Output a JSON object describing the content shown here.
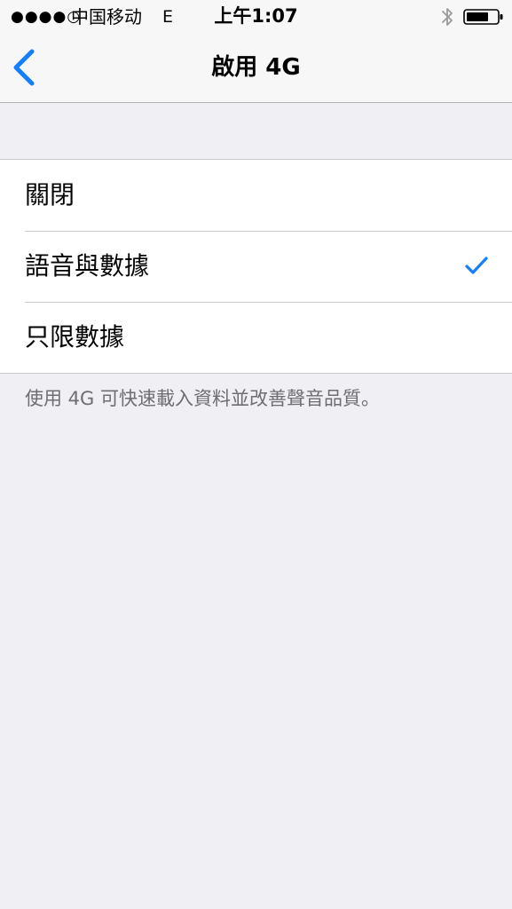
{
  "status_bar": {
    "signal": "●●●●○",
    "carrier": "中国移动",
    "network": "E",
    "time": "上午1:07",
    "bluetooth_icon": "bluetooth-icon",
    "battery_icon": "battery-icon"
  },
  "nav": {
    "back_icon": "chevron-left-icon",
    "title": "啟用 4G"
  },
  "options": [
    {
      "label": "關閉",
      "selected": false
    },
    {
      "label": "語音與數據",
      "selected": true
    },
    {
      "label": "只限數據",
      "selected": false
    }
  ],
  "footer_note": "使用 4G 可快速載入資料並改善聲音品質。",
  "colors": {
    "accent": "#147efb",
    "background": "#efeff4",
    "bar": "#f7f7f7",
    "separator": "#c8c7cc",
    "secondary_text": "#6d6d72"
  }
}
